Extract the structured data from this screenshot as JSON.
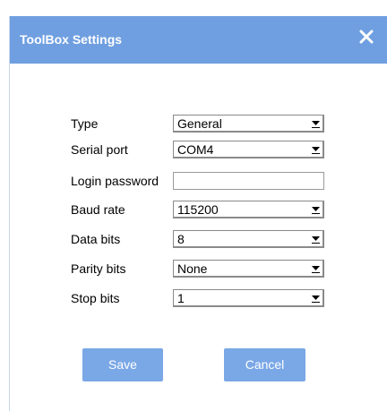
{
  "dialog": {
    "title": "ToolBox Settings",
    "close_icon": "close-icon"
  },
  "form": {
    "type": {
      "label": "Type",
      "value": "General"
    },
    "serial_port": {
      "label": "Serial port",
      "value": "COM4"
    },
    "login_password": {
      "label": "Login password",
      "value": ""
    },
    "baud_rate": {
      "label": "Baud rate",
      "value": "115200"
    },
    "data_bits": {
      "label": "Data bits",
      "value": "8"
    },
    "parity_bits": {
      "label": "Parity bits",
      "value": "None"
    },
    "stop_bits": {
      "label": "Stop bits",
      "value": "1"
    }
  },
  "buttons": {
    "save_label": "Save",
    "cancel_label": "Cancel"
  },
  "colors": {
    "titlebar": "#6f9fe0",
    "button": "#7aa7e6"
  }
}
